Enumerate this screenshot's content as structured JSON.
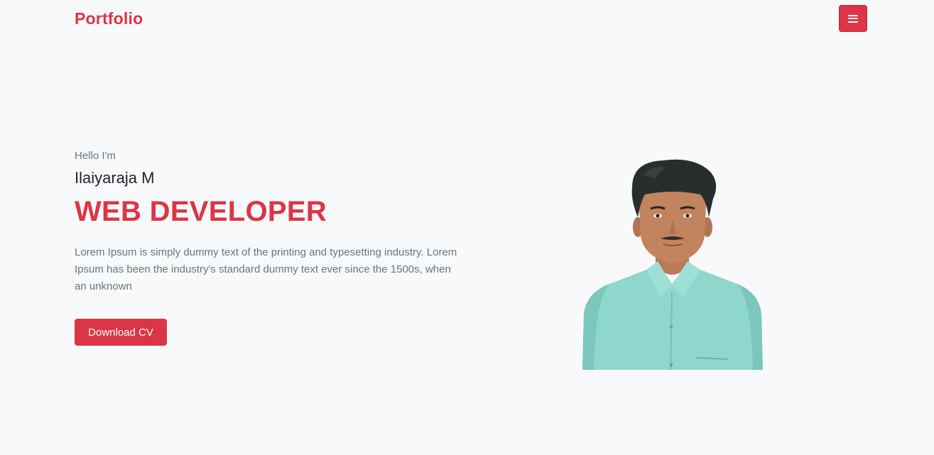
{
  "navbar": {
    "brand": "Portfolio",
    "menu_icon": "hamburger-icon"
  },
  "hero": {
    "greeting": "Hello I'm",
    "name": "Ilaiyaraja M",
    "role": "WEB DEVELOPER",
    "description": "Lorem Ipsum is simply dummy text of the printing and typesetting industry. Lorem Ipsum has been the industry's standard dummy text ever since the 1500s, when an unknown",
    "download_label": "Download CV"
  },
  "colors": {
    "accent": "#dc3545",
    "background": "#f8f9fa",
    "text_muted": "#6c757d",
    "text_dark": "#212529"
  }
}
